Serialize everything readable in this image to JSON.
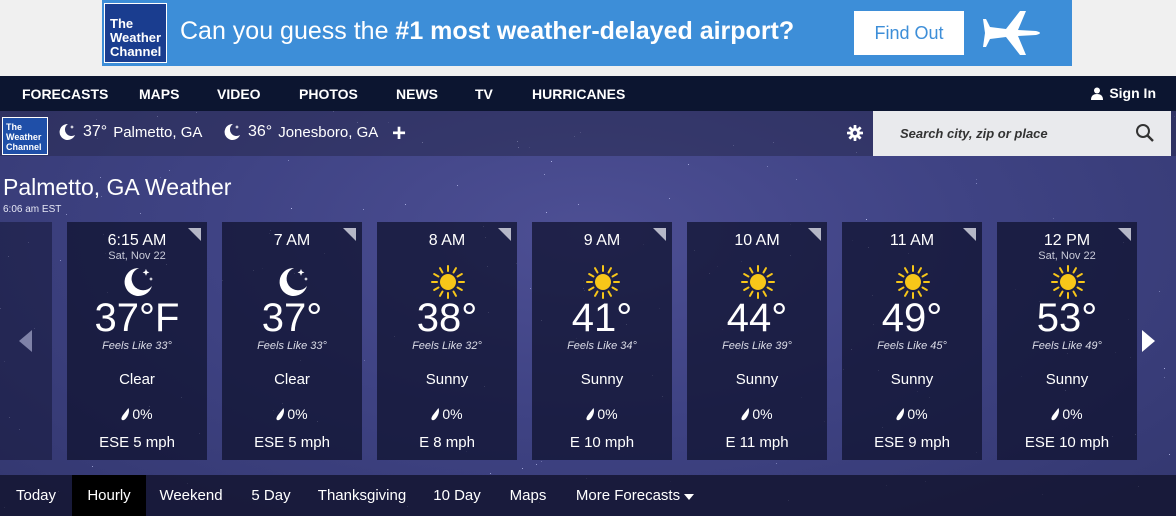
{
  "ad": {
    "logo_line1": "The",
    "logo_line2": "Weather",
    "logo_line3": "Channel",
    "text_prefix": "Can you guess the ",
    "text_bold": "#1 most weather-delayed airport?",
    "button_label": "Find Out",
    "color": "#3d8ed8"
  },
  "nav": {
    "items": [
      "FORECASTS",
      "MAPS",
      "VIDEO",
      "PHOTOS",
      "NEWS",
      "TV",
      "HURRICANES"
    ],
    "signin_label": "Sign In"
  },
  "locations": {
    "logo_line1": "The",
    "logo_line2": "Weather",
    "logo_line3": "Channel",
    "saved": [
      {
        "temp": "37°",
        "name": "Palmetto, GA",
        "icon": "moon-icon"
      },
      {
        "temp": "36°",
        "name": "Jonesboro, GA",
        "icon": "moon-icon"
      }
    ],
    "add_label": "+",
    "search_placeholder": "Search city, zip or place"
  },
  "page": {
    "title": "Palmetto, GA Weather",
    "timestamp": "6:06 am EST"
  },
  "hourly": [
    {
      "time": "6:15 AM",
      "date": "Sat, Nov 22",
      "icon": "moon-icon",
      "temp": "37°F",
      "feels": "Feels Like 33°",
      "condition": "Clear",
      "precip": "0%",
      "wind": "ESE 5 mph"
    },
    {
      "time": "7 AM",
      "date": "",
      "icon": "moon-icon",
      "temp": "37°",
      "feels": "Feels Like 33°",
      "condition": "Clear",
      "precip": "0%",
      "wind": "ESE 5 mph"
    },
    {
      "time": "8 AM",
      "date": "",
      "icon": "sun-icon",
      "temp": "38°",
      "feels": "Feels Like 32°",
      "condition": "Sunny",
      "precip": "0%",
      "wind": "E 8 mph"
    },
    {
      "time": "9 AM",
      "date": "",
      "icon": "sun-icon",
      "temp": "41°",
      "feels": "Feels Like 34°",
      "condition": "Sunny",
      "precip": "0%",
      "wind": "E 10 mph"
    },
    {
      "time": "10 AM",
      "date": "",
      "icon": "sun-icon",
      "temp": "44°",
      "feels": "Feels Like 39°",
      "condition": "Sunny",
      "precip": "0%",
      "wind": "E 11 mph"
    },
    {
      "time": "11 AM",
      "date": "",
      "icon": "sun-icon",
      "temp": "49°",
      "feels": "Feels Like 45°",
      "condition": "Sunny",
      "precip": "0%",
      "wind": "ESE 9 mph"
    },
    {
      "time": "12 PM",
      "date": "Sat, Nov 22",
      "icon": "sun-icon",
      "temp": "53°",
      "feels": "Feels Like 49°",
      "condition": "Sunny",
      "precip": "0%",
      "wind": "ESE 10 mph"
    }
  ],
  "tabs": {
    "items": [
      "Today",
      "Hourly",
      "Weekend",
      "5 Day",
      "Thanksgiving",
      "10 Day",
      "Maps",
      "More Forecasts"
    ],
    "active": "Hourly"
  },
  "colors": {
    "nav_bg": "#0c1530",
    "sun": "#f7c619",
    "accent_blue": "#3d8ed8"
  }
}
